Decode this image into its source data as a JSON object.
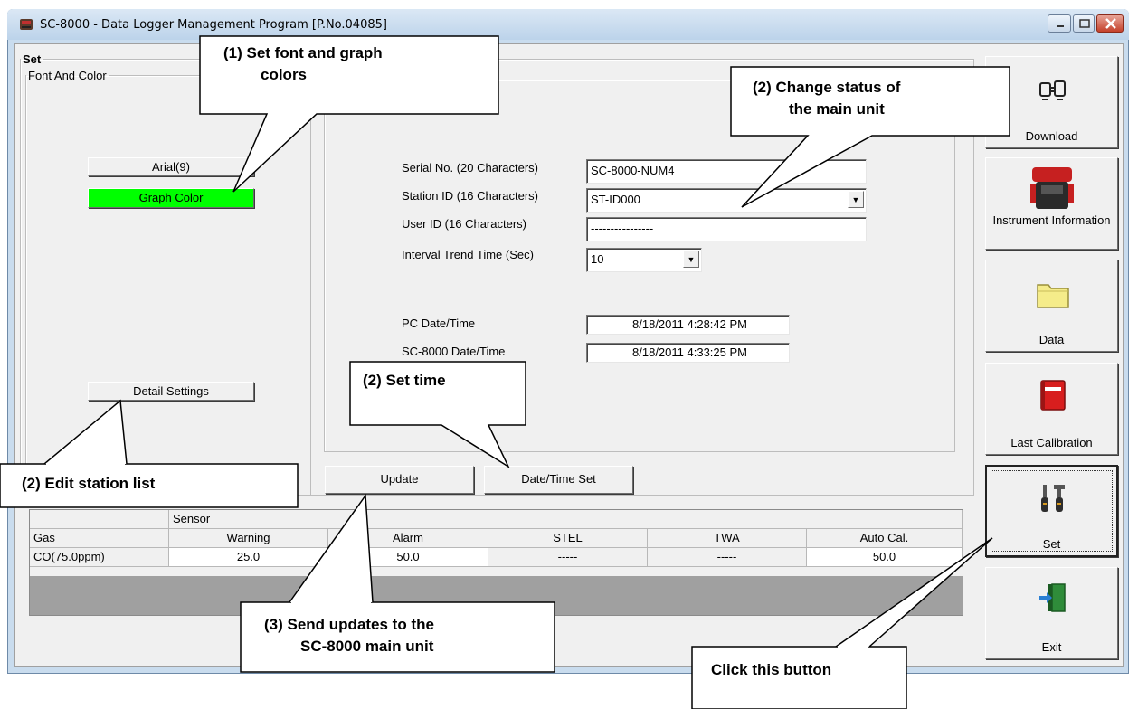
{
  "window": {
    "title": "SC-8000 - Data Logger Management Program [P.No.04085]"
  },
  "set_group": {
    "legend": "Set",
    "font_group": {
      "legend": "Font And Color",
      "font_button": "Arial(9)",
      "graph_color_button": "Graph Color",
      "graph_color": "#00ff00",
      "detail_settings_button": "Detail Settings"
    }
  },
  "form": {
    "serial_label": "Serial No. (20 Characters)",
    "serial_value": "SC-8000-NUM4",
    "station_label": "Station ID (16 Characters)",
    "station_value": "ST-ID000",
    "user_label": "User ID (16 Characters)",
    "user_value": "----------------",
    "interval_label": "Interval Trend Time (Sec)",
    "interval_value": "10",
    "pc_time_label": "PC Date/Time",
    "pc_time_value": "8/18/2011 4:28:42 PM",
    "sc_time_label": "SC-8000 Date/Time",
    "sc_time_value": "8/18/2011 4:33:25 PM"
  },
  "actions": {
    "update": "Update",
    "datetime_set": "Date/Time Set"
  },
  "sensor_table": {
    "group_header": "Sensor",
    "columns": [
      "Gas",
      "Warning",
      "Alarm",
      "STEL",
      "TWA",
      "Auto Cal."
    ],
    "row": [
      "CO(75.0ppm)",
      "25.0",
      "50.0",
      "-----",
      "-----",
      "50.0"
    ]
  },
  "sidebar": {
    "download": "Download",
    "instrument_info": "Instrument Information",
    "data": "Data",
    "last_calibration": "Last Calibration",
    "set": "Set",
    "exit": "Exit"
  },
  "callouts": {
    "c1_line1": "(1)  Set font and graph",
    "c1_line2": "colors",
    "c2_line1": "(2)  Change status of",
    "c2_line2": "the main unit",
    "c3": "(2)  Set time",
    "c4": "(2)  Edit station list",
    "c5_line1": "(3)  Send updates to the",
    "c5_line2": "SC-8000 main unit",
    "c6": "Click this button"
  }
}
